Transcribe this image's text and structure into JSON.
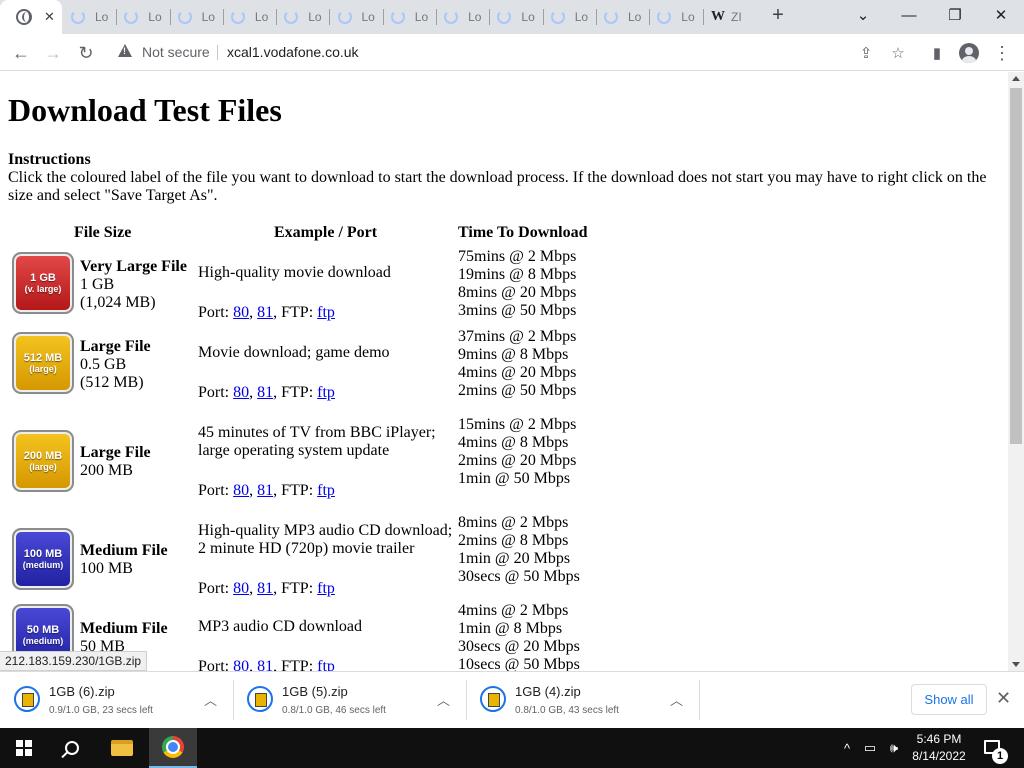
{
  "browser": {
    "active_tab": {
      "title": ""
    },
    "loading_tabs": [
      {
        "title": "Lo"
      },
      {
        "title": "Lo"
      },
      {
        "title": "Lo"
      },
      {
        "title": "Lo"
      },
      {
        "title": "Lo"
      },
      {
        "title": "Lo"
      },
      {
        "title": "Lo"
      },
      {
        "title": "Lo"
      },
      {
        "title": "Lo"
      },
      {
        "title": "Lo"
      },
      {
        "title": "Lo"
      },
      {
        "title": "Lo"
      }
    ],
    "last_tab": {
      "title": "ZI"
    },
    "security_label": "Not secure",
    "url": "xcal1.vodafone.co.uk"
  },
  "page": {
    "title": "Download Test Files",
    "instructions_heading": "Instructions",
    "instructions_text": "Click the coloured label of the file you want to download to start the download process. If the download does not start you may have to right click on the size and select \"Save Target As\".",
    "columns": {
      "size": "File Size",
      "example": "Example / Port",
      "time": "Time To Download"
    },
    "port_label": "Port:",
    "ftp_label": ", FTP:",
    "files": [
      {
        "badge_top": "1 GB",
        "badge_bottom": "(v. large)",
        "color": "red",
        "title": "Very Large File",
        "size": "1 GB",
        "size_mb": "(1,024 MB)",
        "example": "High-quality movie download",
        "port80": "80",
        "port81": "81",
        "ftp": "ftp",
        "times": [
          "75mins @ 2 Mbps",
          "19mins @ 8 Mbps",
          "8mins @ 20 Mbps",
          "3mins @ 50 Mbps"
        ]
      },
      {
        "badge_top": "512 MB",
        "badge_bottom": "(large)",
        "color": "yellow",
        "title": "Large File",
        "size": "0.5 GB",
        "size_mb": "(512 MB)",
        "example": "Movie download; game demo",
        "port80": "80",
        "port81": "81",
        "ftp": "ftp",
        "times": [
          "37mins @ 2 Mbps",
          "9mins @ 8 Mbps",
          "4mins @ 20 Mbps",
          "2mins @ 50 Mbps"
        ]
      },
      {
        "badge_top": "200 MB",
        "badge_bottom": "(large)",
        "color": "yellow",
        "title": "Large File",
        "size": "200 MB",
        "size_mb": "",
        "example": "45 minutes of TV from BBC iPlayer; large operating system update",
        "port80": "80",
        "port81": "81",
        "ftp": "ftp",
        "times": [
          "15mins @ 2 Mbps",
          "4mins @ 8 Mbps",
          "2mins @ 20 Mbps",
          "1min @ 50 Mbps"
        ]
      },
      {
        "badge_top": "100 MB",
        "badge_bottom": "(medium)",
        "color": "blue",
        "title": "Medium File",
        "size": "100 MB",
        "size_mb": "",
        "example": "High-quality MP3 audio CD download; 2 minute HD (720p) movie trailer",
        "port80": "80",
        "port81": "81",
        "ftp": "ftp",
        "times": [
          "8mins @ 2 Mbps",
          "2mins @ 8 Mbps",
          "1min @ 20 Mbps",
          "30secs @ 50 Mbps"
        ]
      },
      {
        "badge_top": "50 MB",
        "badge_bottom": "(medium)",
        "color": "blue",
        "title": "Medium File",
        "size": "50 MB",
        "size_mb": "",
        "example": "MP3 audio CD download",
        "port80": "80",
        "port81": "81",
        "ftp": "ftp",
        "times": [
          "4mins @ 2 Mbps",
          "1min @ 8 Mbps",
          "30secs @ 20 Mbps",
          "10secs @ 50 Mbps"
        ]
      }
    ],
    "status_url": "212.183.159.230/1GB.zip"
  },
  "downloads": {
    "items": [
      {
        "name": "1GB (6).zip",
        "status": "0.9/1.0 GB, 23 secs left"
      },
      {
        "name": "1GB (5).zip",
        "status": "0.8/1.0 GB, 46 secs left"
      },
      {
        "name": "1GB (4).zip",
        "status": "0.8/1.0 GB, 43 secs left"
      }
    ],
    "show_all": "Show all"
  },
  "taskbar": {
    "time": "5:46 PM",
    "date": "8/14/2022",
    "notification_count": "1"
  },
  "colors": {
    "red": "#c62222",
    "yellow": "#e6ad0a",
    "blue": "#3333bb",
    "link": "#0000ee",
    "accent": "#1a73e8"
  }
}
